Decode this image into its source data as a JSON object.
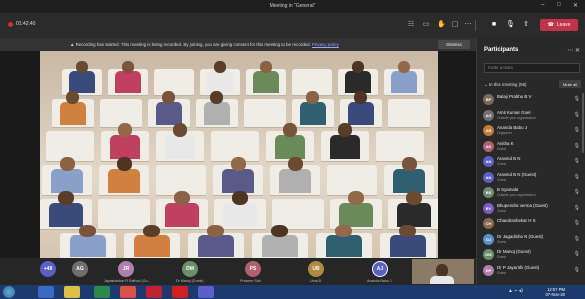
{
  "window": {
    "title": "Meeting in \"General\"",
    "controls": [
      "–",
      "□",
      "✕"
    ]
  },
  "toolbar": {
    "recording_time": "01:42:40",
    "leave_label": "Leave"
  },
  "banner": {
    "text": "Recording has started. This meeting is being recorded. By joining, you are giving consent for this meeting to be recorded.",
    "link": "Privacy policy",
    "dismiss_label": "Dismiss"
  },
  "strip": {
    "chips": [
      {
        "initials": "+48",
        "name": "",
        "color": "#5b5fc7"
      },
      {
        "initials": "AG",
        "name": "",
        "color": "#6f6f6f"
      },
      {
        "initials": "JR",
        "name": "Jayashankar R Rathod (Gu...",
        "color": "#b07fb0"
      },
      {
        "initials": "DM",
        "name": "Dr Manoj (Guest)",
        "color": "#6a8f6a"
      },
      {
        "initials": "PS",
        "name": "Praveen Sah",
        "color": "#b06070"
      },
      {
        "initials": "UB",
        "name": "Uma B",
        "color": "#b08a40"
      },
      {
        "initials": "AJ",
        "name": "Ananda Babu J",
        "color": "#5b5fc7"
      }
    ]
  },
  "panel": {
    "title": "Participants",
    "search_placeholder": "Invite a team",
    "section_label": "In this meeting (56)",
    "mute_all_label": "Mute all",
    "participants": [
      {
        "initials": "BP",
        "name": "Balaji Prabhu B V",
        "sub": "",
        "color": "#7a6a5a"
      },
      {
        "initials": "AG",
        "name": "Amit Kumar Goel",
        "sub": "Outside your organization",
        "color": "#6f6f6f"
      },
      {
        "initials": "AB",
        "name": "Ananda Babu J",
        "sub": "Organizer",
        "color": "#c07a3a"
      },
      {
        "initials": "AK",
        "name": "Anitha K",
        "sub": "Guest",
        "color": "#b06070"
      },
      {
        "initials": "AN",
        "name": "Aravind B N",
        "sub": "Guest",
        "color": "#5b5fc7"
      },
      {
        "initials": "AN",
        "name": "Aravind B N (Guest)",
        "sub": "Guest",
        "color": "#5b5fc7"
      },
      {
        "initials": "BS",
        "name": "B Syamala",
        "sub": "Outside your organization",
        "color": "#6a8f6a"
      },
      {
        "initials": "BV",
        "name": "Bhupendra verma (Guest)",
        "sub": "Guest",
        "color": "#7a5bc7"
      },
      {
        "initials": "CH",
        "name": "Chandrashekar H S",
        "sub": "",
        "color": "#8a6a4a"
      },
      {
        "initials": "DJ",
        "name": "Dr Jagadisha N (Guest)",
        "sub": "Guest",
        "color": "#5b8fc7"
      },
      {
        "initials": "DM",
        "name": "Dr Manoj (Guest)",
        "sub": "Guest",
        "color": "#6a8f6a"
      },
      {
        "initials": "DP",
        "name": "Dr P Jayanthi (Guest)",
        "sub": "Guest",
        "color": "#b07fb0"
      }
    ]
  },
  "taskbar": {
    "time": "12:57 PM",
    "date": "07-Nov-20"
  }
}
